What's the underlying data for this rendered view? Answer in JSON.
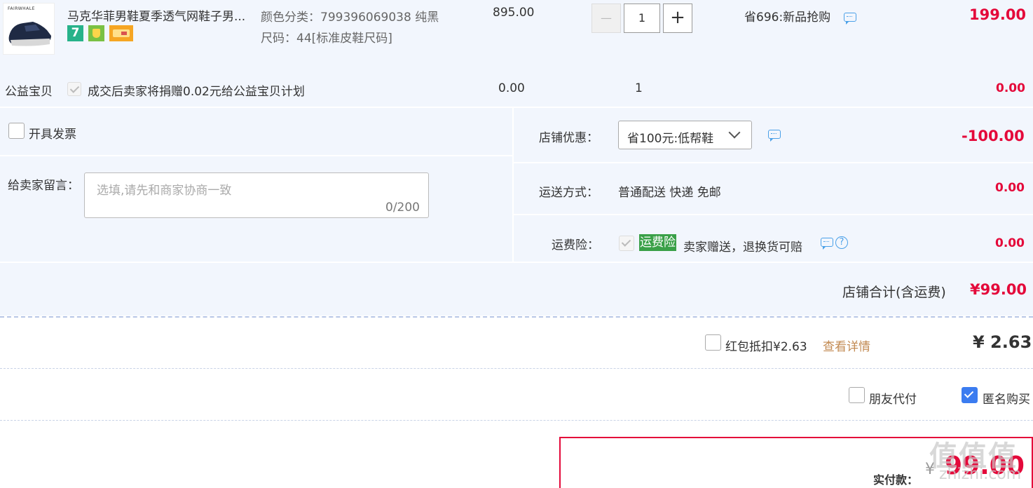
{
  "item": {
    "title": "马克华菲男鞋夏季透气网鞋子男...",
    "thumb_brand": "FAIRWHALE",
    "badges": [
      {
        "name": "seven-day-return-icon",
        "label": "7",
        "color": "#27b28a"
      },
      {
        "name": "android-shield-icon",
        "label": "",
        "color": "#6fbf3a"
      },
      {
        "name": "card-icon",
        "label": "",
        "color": "#f5a623"
      }
    ],
    "sku_color": "颜色分类：799396069038 纯黑",
    "sku_size": "尺码：44[标准皮鞋尺码]",
    "orig_price": "895.00",
    "qty": "1",
    "qty_minus": "—",
    "qty_plus": "+",
    "promo": "省696:新品抢购",
    "price": "199.00"
  },
  "charity": {
    "label": "公益宝贝",
    "desc": "成交后卖家将捐赠0.02元给公益宝贝计划",
    "price": "0.00",
    "qty": "1",
    "total": "0.00"
  },
  "invoice": {
    "label": "开具发票"
  },
  "message": {
    "label": "给卖家留言：",
    "placeholder": "选填,请先和商家协商一致",
    "counter": "0/200"
  },
  "shop_discount": {
    "label": "店铺优惠：",
    "selected": "省100元:低帮鞋",
    "amount": "-100.00"
  },
  "shipping": {
    "label": "运送方式：",
    "value": "普通配送 快递 免邮",
    "amount": "0.00"
  },
  "insurance": {
    "label": "运费险：",
    "tag": "运费险",
    "desc": "卖家赠送，退换货可赔",
    "amount": "0.00",
    "tag_color": "#3aa048"
  },
  "shop_total": {
    "label": "店铺合计(含运费)",
    "amount": "¥99.00"
  },
  "redpacket": {
    "label": "红包抵扣¥2.63",
    "link": "查看详情",
    "amount": "¥ 2.63"
  },
  "options": {
    "friend_pay": "朋友代付",
    "anonymous": "匿名购买"
  },
  "payment": {
    "label": "实付款：",
    "currency": "¥",
    "amount": "99.00"
  },
  "watermark": "值 值 值",
  "watermark_url": "zhizhi.com"
}
